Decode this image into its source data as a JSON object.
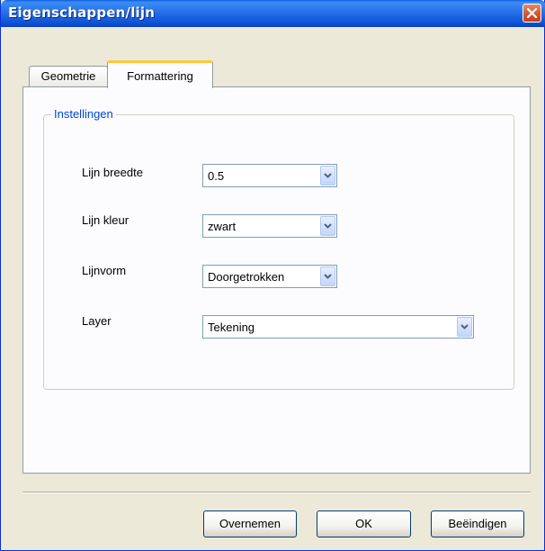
{
  "window": {
    "title": "Eigenschappen/lijn"
  },
  "tabs": [
    {
      "label": "Geometrie",
      "active": false
    },
    {
      "label": "Formattering",
      "active": true
    }
  ],
  "group": {
    "title": "Instellingen"
  },
  "fields": [
    {
      "label": "Lijn breedte",
      "value": "0.5"
    },
    {
      "label": "Lijn kleur",
      "value": "zwart"
    },
    {
      "label": "Lijnvorm",
      "value": "Doorgetrokken"
    },
    {
      "label": "Layer",
      "value": "Tekening"
    }
  ],
  "buttons": {
    "apply": "Overnemen",
    "ok": "OK",
    "close": "Beëindigen"
  },
  "colors": {
    "titlebar": "#2a73ea",
    "active_tab_accent": "#ffc83c",
    "group_title": "#0046d5",
    "dialog_bg": "#ece9d8"
  },
  "icons": {
    "close": "close-icon",
    "dropdown": "chevron-down-icon"
  }
}
